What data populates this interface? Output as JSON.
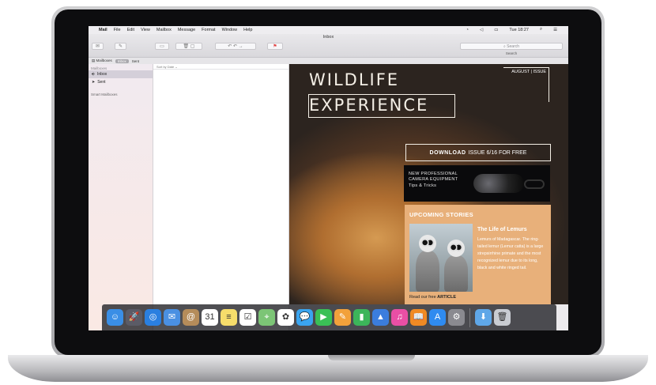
{
  "menubar": {
    "apple": "",
    "app": "Mail",
    "items": [
      "File",
      "Edit",
      "View",
      "Mailbox",
      "Message",
      "Format",
      "Window",
      "Help"
    ],
    "clock": "Tue 18:27"
  },
  "window": {
    "title": "Inbox"
  },
  "toolbar": {
    "search_placeholder": "Search",
    "search_caption": "Search"
  },
  "tabbar": {
    "mailboxes": "Mailboxes",
    "inbox": "Inbox",
    "sent": "Sent"
  },
  "sidebar": {
    "header": "Mailboxes",
    "items": [
      {
        "label": "Inbox"
      },
      {
        "label": "Sent"
      }
    ],
    "smart": "Smart Mailboxes"
  },
  "message_list": {
    "sort": "Sort by Date ⌄"
  },
  "magazine": {
    "title_line1": "WILDLIFE",
    "title_line2": "EXPERIENCE",
    "issue": "AUGUST | ISSUE",
    "download_bold": "DOWNLOAD",
    "download_rest": "ISSUE 6/16 FOR FREE",
    "camera_line1": "NEW PROFESSIONAL",
    "camera_line2": "CAMERA EQUIPMENT",
    "camera_line3": "Tips & Tricks",
    "upcoming": "UPCOMING STORIES",
    "story_title": "The Life of Lemurs",
    "story_body": "Lemurs of Madagascar. The ring-tailed lemur (Lemur catta) is a large strepsirrhine primate and the most recognized lemur due to its long, black and white ringed tail.",
    "read_prefix": "Read our free",
    "read_bold": "ARTICLE"
  },
  "dock": {
    "apps": [
      {
        "name": "finder-icon",
        "glyph": "☺",
        "color": "#3a8ee6"
      },
      {
        "name": "launchpad-icon",
        "glyph": "🚀",
        "color": "#5b5b66"
      },
      {
        "name": "safari-icon",
        "glyph": "◎",
        "color": "#2a7fe0"
      },
      {
        "name": "mail-icon",
        "glyph": "✉",
        "color": "#4a90e2"
      },
      {
        "name": "contacts-icon",
        "glyph": "@",
        "color": "#b58c5a"
      },
      {
        "name": "calendar-icon",
        "glyph": "31",
        "color": "#ffffff"
      },
      {
        "name": "notes-icon",
        "glyph": "≡",
        "color": "#f6dd6b"
      },
      {
        "name": "reminders-icon",
        "glyph": "☑",
        "color": "#ffffff"
      },
      {
        "name": "maps-icon",
        "glyph": "⌖",
        "color": "#7cc576"
      },
      {
        "name": "photos-icon",
        "glyph": "✿",
        "color": "#ffffff"
      },
      {
        "name": "messages-icon",
        "glyph": "💬",
        "color": "#3aa5f0"
      },
      {
        "name": "facetime-icon",
        "glyph": "▶",
        "color": "#3ac056"
      },
      {
        "name": "pages-icon",
        "glyph": "✎",
        "color": "#f2a13b"
      },
      {
        "name": "numbers-icon",
        "glyph": "▮",
        "color": "#3cb55a"
      },
      {
        "name": "keynote-icon",
        "glyph": "▲",
        "color": "#3b7ddd"
      },
      {
        "name": "itunes-icon",
        "glyph": "♫",
        "color": "#e94fa5"
      },
      {
        "name": "ibooks-icon",
        "glyph": "📖",
        "color": "#f08a24"
      },
      {
        "name": "app-store-icon",
        "glyph": "A",
        "color": "#2f8bf0"
      },
      {
        "name": "system-preferences-icon",
        "glyph": "⚙",
        "color": "#8a8a90"
      }
    ],
    "right": [
      {
        "name": "downloads-folder-icon",
        "glyph": "⬇",
        "color": "#5fa7e8"
      },
      {
        "name": "trash-icon",
        "glyph": "🗑",
        "color": "#c9ccd2"
      }
    ]
  }
}
